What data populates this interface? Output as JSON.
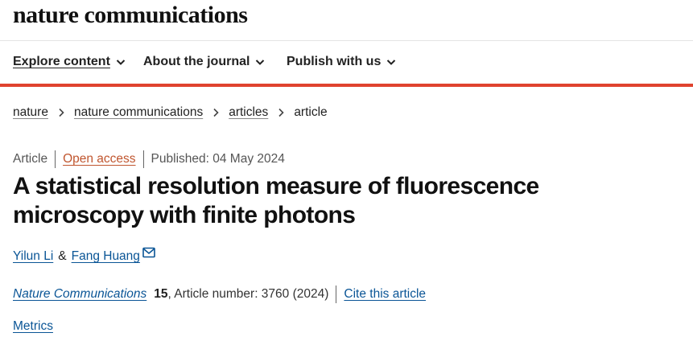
{
  "header": {
    "logo_text": "nature communications"
  },
  "nav": {
    "items": [
      {
        "label": "Explore content",
        "icon": "chevron-down-icon"
      },
      {
        "label": "About the journal",
        "icon": "chevron-down-icon"
      },
      {
        "label": "Publish with us",
        "icon": "chevron-down-icon"
      }
    ],
    "accent_color": "#e0432f"
  },
  "breadcrumb": {
    "items": [
      "nature",
      "nature communications",
      "articles"
    ],
    "current": "article",
    "separator_icon": "chevron-right-icon"
  },
  "article": {
    "type": "Article",
    "access": "Open access",
    "published": "Published: 04 May 2024",
    "title": "A statistical resolution measure of fluorescence microscopy with finite photons",
    "authors": [
      "Yilun Li",
      "Fang Huang"
    ],
    "author_separator": "&",
    "contact_icon": "mail-icon",
    "journal": "Nature Communications",
    "volume": "15",
    "article_number": ", Article number: 3760 (2024)",
    "cite_label": "Cite this article",
    "metrics_label": "Metrics"
  },
  "colors": {
    "link": "#0a5596",
    "open_access": "#c0562f",
    "text": "#222222"
  }
}
